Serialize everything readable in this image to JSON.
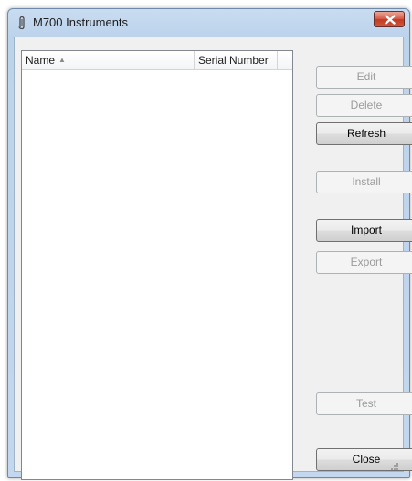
{
  "window": {
    "title": "M700 Instruments"
  },
  "list": {
    "columns": [
      {
        "label": "Name",
        "sort_indicator": "▲"
      },
      {
        "label": "Serial Number"
      }
    ],
    "rows": []
  },
  "buttons": {
    "edit": {
      "label": "Edit",
      "enabled": false
    },
    "delete": {
      "label": "Delete",
      "enabled": false
    },
    "refresh": {
      "label": "Refresh",
      "enabled": true
    },
    "install": {
      "label": "Install",
      "enabled": false
    },
    "import": {
      "label": "Import",
      "enabled": true
    },
    "export": {
      "label": "Export",
      "enabled": false
    },
    "test": {
      "label": "Test",
      "enabled": false
    },
    "close": {
      "label": "Close",
      "enabled": true
    }
  },
  "icons": {
    "title_icon": "paperclip-icon",
    "close_icon": "close-x-icon",
    "grip_icon": "resize-grip-icon"
  },
  "colors": {
    "titlebar": "#c9dcf0",
    "close_button": "#c33a22",
    "dialog_background": "#f0f0f0"
  }
}
